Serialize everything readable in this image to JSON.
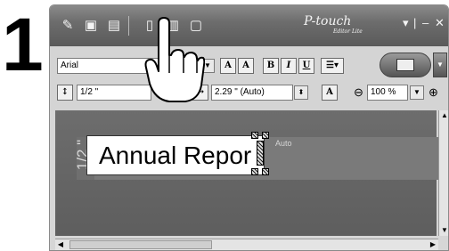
{
  "step": {
    "number": "1"
  },
  "titlebar": {
    "brand": "P-touch",
    "brand_sub": "Editor Lite",
    "controls": [
      "▾",
      "|",
      "–",
      "✕"
    ]
  },
  "toolbar": {
    "font_name": "Arial",
    "font_size": "",
    "tape_width": "1/2 \"",
    "tape_length": "2.29 \" (Auto)",
    "format_buttons": [
      "A",
      "A",
      "B",
      "I",
      "U"
    ],
    "zoom": "100 %",
    "zoom_out": "⊖",
    "zoom_in": "⊕"
  },
  "canvas": {
    "tape_width_label": "1/2 \"",
    "auto_label": "Auto",
    "text": "Annual Repor"
  },
  "colors": {
    "titlebar": "#6d6d6d",
    "toolbar": "#d4d4d4",
    "canvas": "#666666",
    "tape": "#7a7a7a"
  }
}
